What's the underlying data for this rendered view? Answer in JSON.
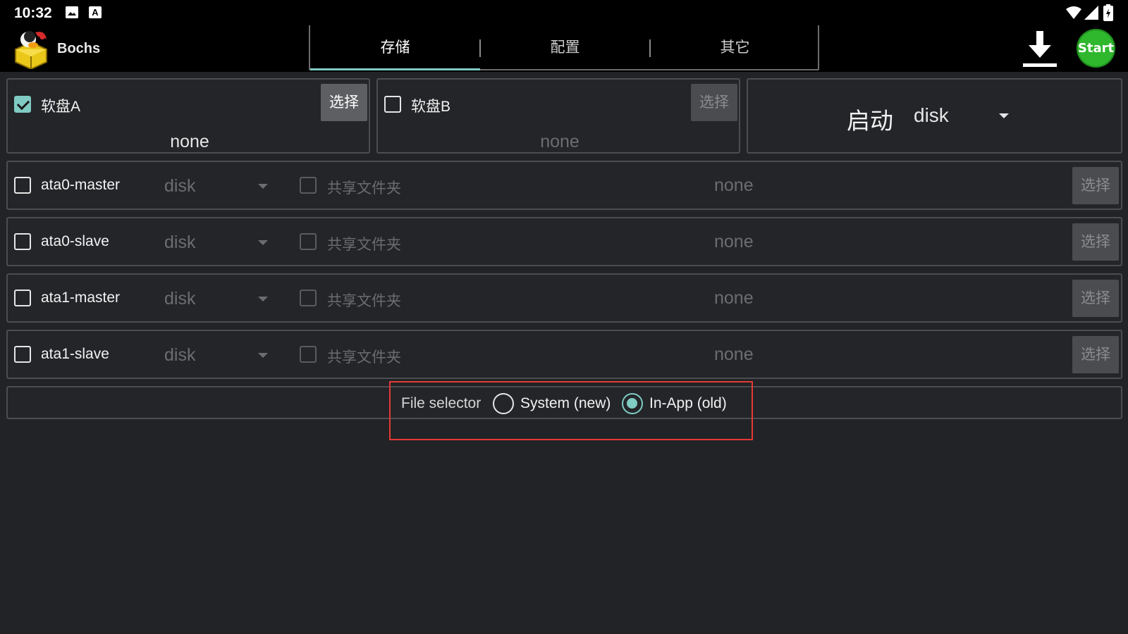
{
  "status_bar": {
    "time": "10:32",
    "icons": [
      "image-notification-icon",
      "a-notification-icon",
      "wifi-icon",
      "signal-icon",
      "battery-icon"
    ]
  },
  "app_bar": {
    "app_name": "Bochs",
    "tabs": [
      {
        "label": "存储",
        "active": true
      },
      {
        "label": "配置",
        "active": false
      },
      {
        "label": "其它",
        "active": false
      }
    ],
    "download_icon": "download-icon",
    "start_label": "Start"
  },
  "floppy_a": {
    "checked": true,
    "label": "软盘A",
    "button": "选择",
    "value": "none"
  },
  "floppy_b": {
    "checked": false,
    "label": "软盘B",
    "button": "选择",
    "value": "none"
  },
  "boot": {
    "label": "启动",
    "value": "disk"
  },
  "ata_rows": [
    {
      "label": "ata0-master",
      "type": "disk",
      "shared_label": "共享文件夹",
      "value": "none",
      "button": "选择"
    },
    {
      "label": "ata0-slave",
      "type": "disk",
      "shared_label": "共享文件夹",
      "value": "none",
      "button": "选择"
    },
    {
      "label": "ata1-master",
      "type": "disk",
      "shared_label": "共享文件夹",
      "value": "none",
      "button": "选择"
    },
    {
      "label": "ata1-slave",
      "type": "disk",
      "shared_label": "共享文件夹",
      "value": "none",
      "button": "选择"
    }
  ],
  "file_selector": {
    "label": "File selector",
    "options": [
      {
        "label": "System (new)",
        "selected": false
      },
      {
        "label": "In-App (old)",
        "selected": true
      }
    ]
  },
  "colors": {
    "accent": "#80cbc4",
    "background": "#212326",
    "start_green": "#2fb72d",
    "highlight_red": "#e53935"
  }
}
